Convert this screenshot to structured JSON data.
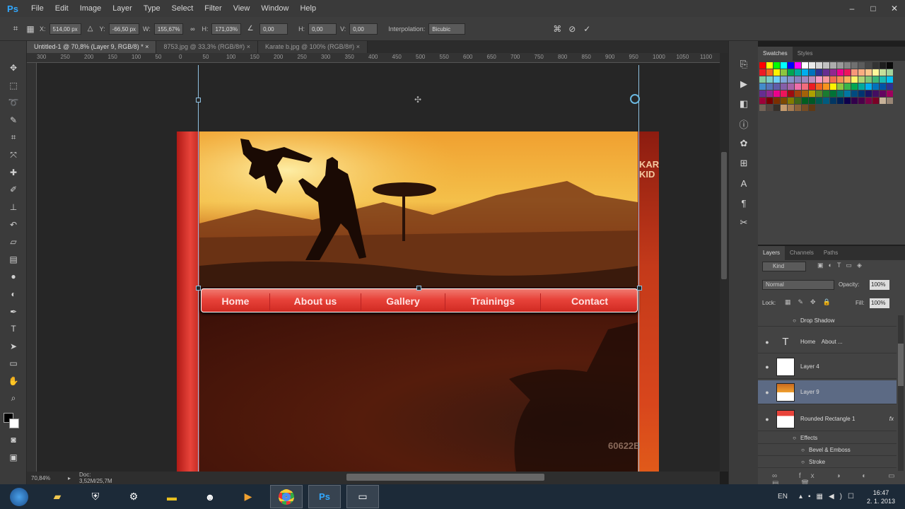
{
  "app": {
    "logo": "Ps",
    "menu": [
      "File",
      "Edit",
      "Image",
      "Layer",
      "Type",
      "Select",
      "Filter",
      "View",
      "Window",
      "Help"
    ],
    "window_buttons": [
      "–",
      "□",
      "✕"
    ]
  },
  "options": {
    "x_label": "X:",
    "x": "514,00 px",
    "y_label": "Y:",
    "y": "-66,50 px",
    "w_label": "W:",
    "w": "155,67%",
    "h_label": "H:",
    "h": "171,03%",
    "angle": "0,00",
    "h_skew_label": "H:",
    "h_skew": "0,00",
    "v_skew_label": "V:",
    "v_skew": "0,00",
    "interp_label": "Interpolation:",
    "interp": "Bicubic"
  },
  "tabs": [
    {
      "label": "Untitled-1 @ 70,8% (Layer 9, RGB/8) *"
    },
    {
      "label": "8753.jpg @ 33,3% (RGB/8#)"
    },
    {
      "label": "Karate b.jpg @ 100% (RGB/8#)"
    }
  ],
  "ruler_ticks": [
    "300",
    "250",
    "200",
    "150",
    "100",
    "50",
    "0",
    "50",
    "100",
    "150",
    "200",
    "250",
    "300",
    "350",
    "400",
    "450",
    "500",
    "550",
    "600",
    "650",
    "700",
    "750",
    "800",
    "850",
    "900",
    "950",
    "1000",
    "1050",
    "1100"
  ],
  "canvas": {
    "nav": [
      "Home",
      "About us",
      "Gallery",
      "Trainings",
      "Contact"
    ],
    "side_text": [
      "KAR",
      "KID"
    ],
    "bottom_text": "60622B"
  },
  "status": {
    "zoom": "70,84%",
    "doc": "Doc: 3,52M/25,7M"
  },
  "swatches": {
    "tabs": [
      "Swatches",
      "Styles"
    ],
    "colors": [
      "#ff0000",
      "#ffff00",
      "#00ff00",
      "#00ffff",
      "#0000ff",
      "#ff00ff",
      "#ffffff",
      "#ebebeb",
      "#d6d6d6",
      "#c2c2c2",
      "#adadad",
      "#999999",
      "#858585",
      "#707070",
      "#5c5c5c",
      "#474747",
      "#333333",
      "#1f1f1f",
      "#0a0a0a",
      "#ed1c24",
      "#f26522",
      "#fff200",
      "#8dc63f",
      "#00a651",
      "#00a99d",
      "#00aeef",
      "#0072bc",
      "#2e3192",
      "#662d91",
      "#92278f",
      "#ec008c",
      "#ed145b",
      "#f7977a",
      "#f9ad81",
      "#fdc68a",
      "#fff79a",
      "#c4df9b",
      "#a3d39c",
      "#82ca9d",
      "#7bcdc8",
      "#6ecff6",
      "#7ea7d8",
      "#8493ca",
      "#8882be",
      "#a187be",
      "#bc8dbf",
      "#f49ac2",
      "#f6989d",
      "#f26c4f",
      "#f68e55",
      "#fbaf5c",
      "#fff467",
      "#acd372",
      "#7cc576",
      "#3bb878",
      "#1abbb4",
      "#00bff3",
      "#438ccb",
      "#5574b9",
      "#605ca8",
      "#855fa8",
      "#a763a8",
      "#f06eaa",
      "#f26d7d",
      "#ed1c24",
      "#f26522",
      "#f7941d",
      "#fff200",
      "#8dc63f",
      "#39b54a",
      "#00a651",
      "#00a99d",
      "#00aeef",
      "#0072bc",
      "#0054a6",
      "#2e3192",
      "#662d91",
      "#92278f",
      "#ec008c",
      "#ed145b",
      "#9e0b0f",
      "#a0410d",
      "#a36209",
      "#aba000",
      "#598527",
      "#1a7b30",
      "#007236",
      "#00746b",
      "#0076a3",
      "#004b80",
      "#003471",
      "#1b1464",
      "#440e62",
      "#630460",
      "#9e005d",
      "#9e0039",
      "#790000",
      "#7b2e00",
      "#7d4900",
      "#827b00",
      "#406618",
      "#005e20",
      "#005826",
      "#005952",
      "#005b7f",
      "#003663",
      "#002157",
      "#0d004c",
      "#32004b",
      "#4b0049",
      "#7b0046",
      "#7a0026",
      "#c7b299",
      "#998675",
      "#736357",
      "#534741",
      "#37302a",
      "#c69c6d",
      "#a67c52",
      "#8c6239",
      "#754c24",
      "#603913"
    ]
  },
  "layers": {
    "tabs": [
      "Layers",
      "Channels",
      "Paths"
    ],
    "kind": "Kind",
    "blend": "Normal",
    "opacity_label": "Opacity:",
    "opacity": "100%",
    "lock_label": "Lock:",
    "fill_label": "Fill:",
    "fill": "100%",
    "items": [
      {
        "name": "Drop Shadow",
        "type": "effect"
      },
      {
        "name": "Home    About ...",
        "type": "text"
      },
      {
        "name": "Layer 4",
        "type": "layer"
      },
      {
        "name": "Layer 9",
        "type": "layer",
        "selected": true
      },
      {
        "name": "Rounded Rectangle 1",
        "type": "layer",
        "fx": "fx"
      },
      {
        "name": "Effects",
        "type": "effect"
      },
      {
        "name": "Bevel & Emboss",
        "type": "effect"
      },
      {
        "name": "Stroke",
        "type": "effect"
      }
    ]
  },
  "taskbar": {
    "lang": "EN",
    "time": "16:47",
    "date": "2. 1. 2013"
  }
}
